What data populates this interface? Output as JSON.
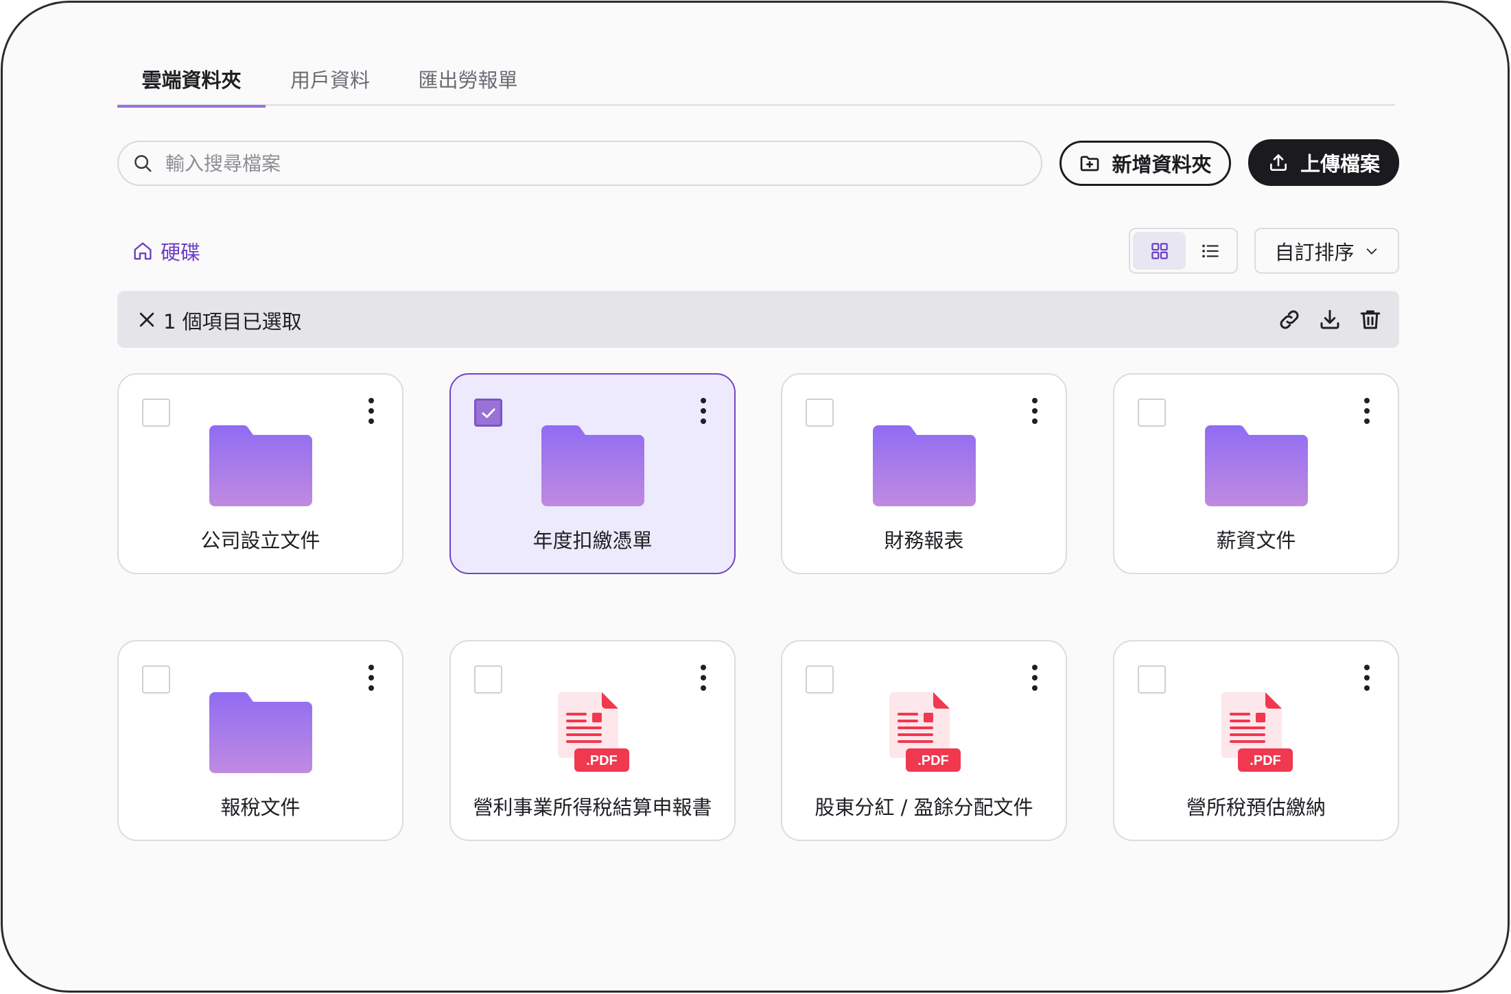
{
  "tabs": [
    {
      "label": "雲端資料夾",
      "active": true
    },
    {
      "label": "用戶資料",
      "active": false
    },
    {
      "label": "匯出勞報單",
      "active": false
    }
  ],
  "search": {
    "placeholder": "輸入搜尋檔案",
    "value": ""
  },
  "toolbar": {
    "new_folder_label": "新增資料夾",
    "upload_label": "上傳檔案"
  },
  "breadcrumb": {
    "root_label": "硬碟"
  },
  "view": {
    "mode": "grid"
  },
  "sort": {
    "label": "自訂排序"
  },
  "selection": {
    "text": "1 個項目已選取"
  },
  "items": [
    {
      "name": "公司設立文件",
      "type": "folder",
      "selected": false
    },
    {
      "name": "年度扣繳憑單",
      "type": "folder",
      "selected": true
    },
    {
      "name": "財務報表",
      "type": "folder",
      "selected": false
    },
    {
      "name": "薪資文件",
      "type": "folder",
      "selected": false
    },
    {
      "name": "報稅文件",
      "type": "folder",
      "selected": false
    },
    {
      "name": "營利事業所得稅結算申報書",
      "type": "pdf",
      "selected": false
    },
    {
      "name": "股東分紅 / 盈餘分配文件",
      "type": "pdf",
      "selected": false
    },
    {
      "name": "營所稅預估繳納",
      "type": "pdf",
      "selected": false
    }
  ],
  "pdf_badge": ".PDF",
  "colors": {
    "accent": "#6e45c6",
    "accent_light": "#9a72d6",
    "folder_top": "#8f6cf2",
    "folder_bottom": "#c08ae0",
    "pdf_red": "#f0384f",
    "primary_button": "#1b1b1f"
  }
}
